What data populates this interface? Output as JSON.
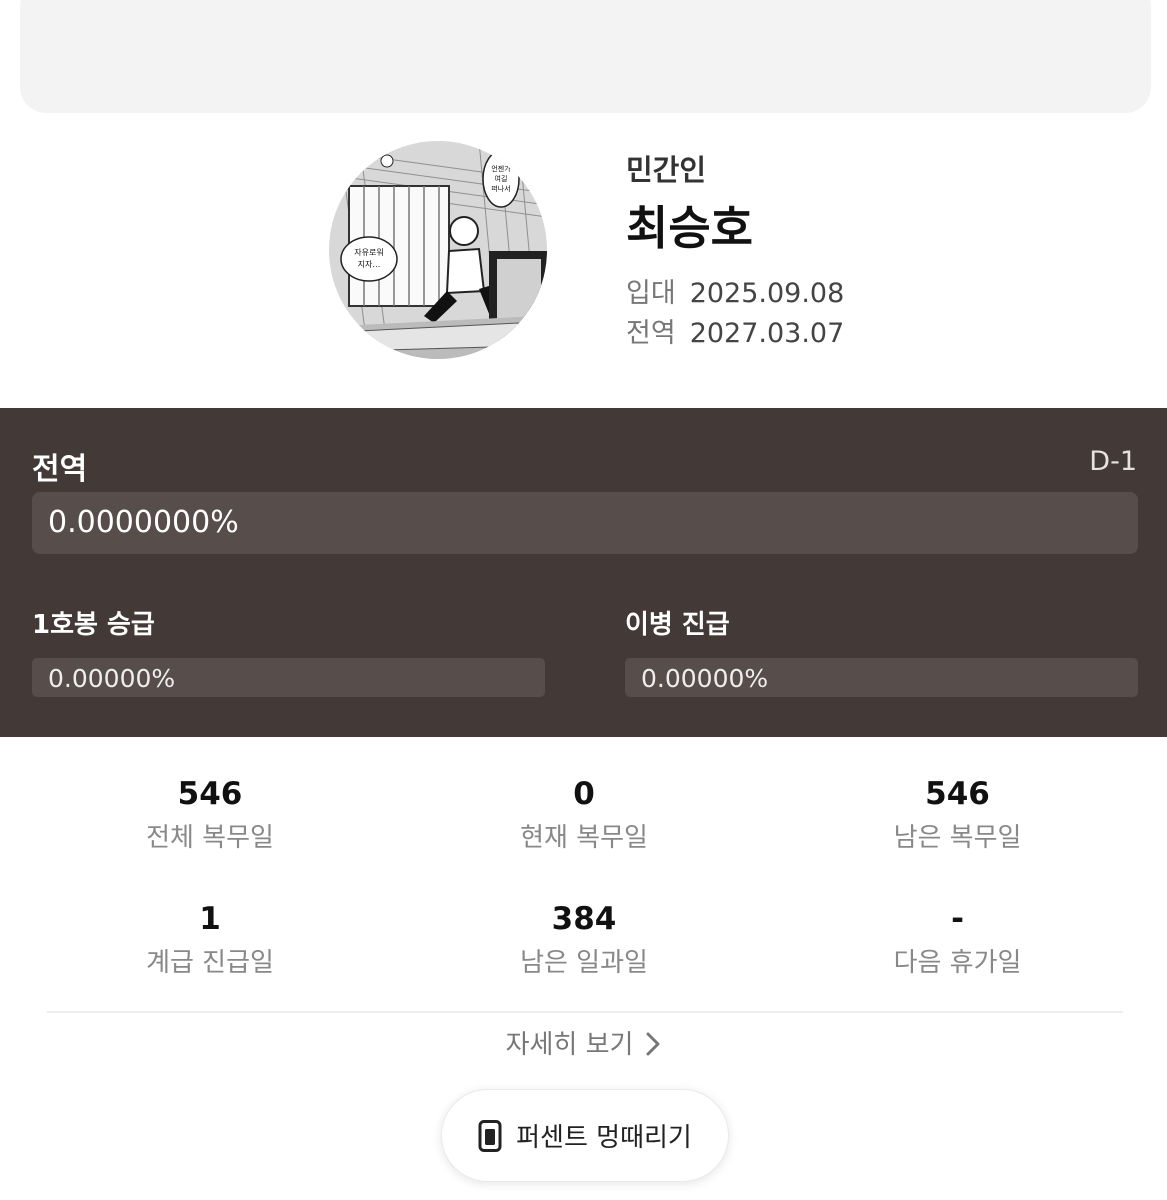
{
  "profile": {
    "role": "민간인",
    "name": "최승호",
    "enlist_label": "입대",
    "enlist_date": "2025.09.08",
    "discharge_label": "전역",
    "discharge_date": "2027.03.07",
    "avatar_speech_1": "자유로워 지자…",
    "avatar_speech_2": "언젠가 여길 떠나서"
  },
  "discharge": {
    "title": "전역",
    "dday": "D-1",
    "progress_text": "0.0000000%",
    "progress_fraction": 0
  },
  "promotions": [
    {
      "title": "1호봉 승급",
      "progress_text": "0.00000%",
      "progress_fraction": 0
    },
    {
      "title": "이병 진급",
      "progress_text": "0.00000%",
      "progress_fraction": 0
    }
  ],
  "stats": [
    {
      "value": "546",
      "label": "전체 복무일"
    },
    {
      "value": "0",
      "label": "현재 복무일"
    },
    {
      "value": "546",
      "label": "남은 복무일"
    },
    {
      "value": "1",
      "label": "계급 진급일"
    },
    {
      "value": "384",
      "label": "남은 일과일"
    },
    {
      "value": "-",
      "label": "다음 휴가일"
    }
  ],
  "more_label": "자세히 보기",
  "percent_button_label": "퍼센트 멍때리기",
  "colors": {
    "panel_bg": "#433937",
    "bar_track": "#574d4b",
    "banner_bg": "#f3f3f3"
  }
}
